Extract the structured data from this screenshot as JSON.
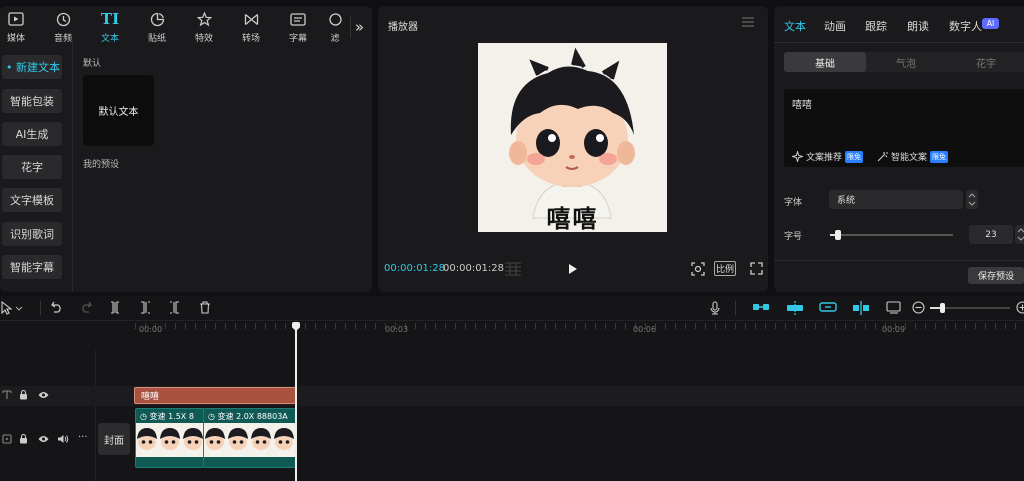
{
  "toolbar": {
    "tabs": [
      {
        "label": "媒体",
        "icon": "media-icon"
      },
      {
        "label": "音频",
        "icon": "audio-icon"
      },
      {
        "label": "文本",
        "icon": "text-icon"
      },
      {
        "label": "贴纸",
        "icon": "sticker-icon"
      },
      {
        "label": "特效",
        "icon": "effects-icon"
      },
      {
        "label": "转场",
        "icon": "transition-icon"
      },
      {
        "label": "字幕",
        "icon": "subtitle-icon"
      },
      {
        "label": "滤",
        "icon": "filter-icon"
      }
    ],
    "more": "»"
  },
  "sidebar": {
    "items": [
      {
        "label": "• 新建文本"
      },
      {
        "label": "智能包装"
      },
      {
        "label": "AI生成"
      },
      {
        "label": "花字"
      },
      {
        "label": "文字模板"
      },
      {
        "label": "识别歌词"
      },
      {
        "label": "智能字幕"
      }
    ]
  },
  "text_library": {
    "section_default": "默认",
    "default_card_label": "默认文本",
    "section_presets": "我的预设"
  },
  "player": {
    "title": "播放器",
    "current_time": "00:00:01:28",
    "total_time": "00:00:01:28",
    "ratio_label": "比例",
    "caption": "嘻嘻"
  },
  "right_panel": {
    "tabs": [
      "文本",
      "动画",
      "跟踪",
      "朗读",
      "数字人"
    ],
    "ai_badge": "AI",
    "subtabs": [
      "基础",
      "气泡",
      "花字"
    ],
    "text_value": "嘻嘻",
    "copy_recommend": "文案推荐",
    "smart_copy": "智能文案",
    "free_badge": "限免",
    "font_label": "字体",
    "font_value": "系统",
    "size_label": "字号",
    "size_value": "23",
    "size_fraction": 0.05,
    "save_preset": "保存预设"
  },
  "timeline": {
    "ticks": [
      "00:00",
      "00:03",
      "00:06",
      "00:09"
    ],
    "text_clip": "嘻嘻",
    "cover_label": "封面",
    "video_clips": [
      {
        "speed": "变速 1.5X",
        "name": "8"
      },
      {
        "speed": "变速 2.0X",
        "name": "88803A"
      }
    ]
  },
  "colors": {
    "accent": "#33c8e6",
    "text_clip": "#a8523f",
    "video_clip": "#0f5a55"
  }
}
